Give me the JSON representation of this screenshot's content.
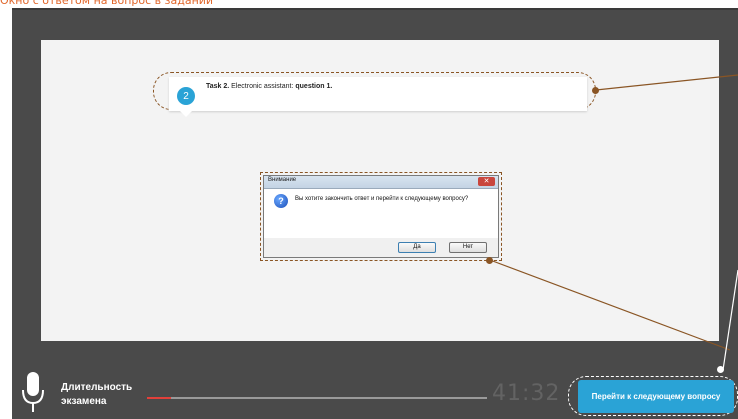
{
  "caption": "Окно с ответом на вопрос в задании",
  "task": {
    "number": "2",
    "title": "Task 2.",
    "subtitle": "Electronic assistant:",
    "question": "question 1."
  },
  "dialog": {
    "title": "Внимание",
    "close_glyph": "✕",
    "icon_glyph": "?",
    "message": "Вы хотите закончить ответ и перейти к следующему вопросу?",
    "yes_label": "Да",
    "no_label": "Нет"
  },
  "footer": {
    "duration_label": "Длительность экзамена",
    "timer": "41:32",
    "progress_fraction": 0.07,
    "next_button_label": "Перейти к следующему вопросу"
  },
  "colors": {
    "accent": "#2aa3d6",
    "callout": "#8a5524",
    "progress": "#e2403a",
    "frame": "#4a4a4a"
  }
}
